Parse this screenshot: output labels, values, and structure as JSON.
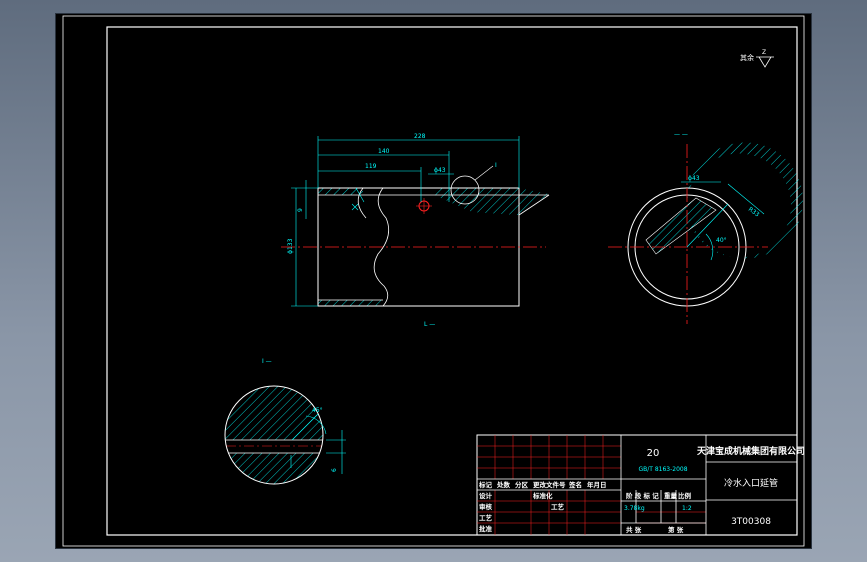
{
  "roughness": {
    "label": "其余",
    "symbol": "Z"
  },
  "view_labels": {
    "top_right": "— —",
    "bottom_left": "I —",
    "below_main": "L —"
  },
  "dimensions": {
    "overall_length": "228",
    "length_140": "140",
    "length_119": "119",
    "hole_dia": "ϕ43",
    "detail_ref": "I",
    "height_9": "9",
    "outer_dia": "ϕ133",
    "end_hole_dia": "ϕ43",
    "end_radius": "R33",
    "end_angle": "40°",
    "detail_angle": "45°",
    "detail_6": "6"
  },
  "title_block": {
    "material": "20",
    "standard": "GB/T 8163-2008",
    "company": "天津宝成机械集团有限公司",
    "part_name": "冷水入口延管",
    "drawing_number": "3T00308",
    "header_cells": [
      "标记",
      "处数",
      "分区",
      "更改文件号",
      "签名",
      "年月日"
    ],
    "row_labels": [
      "设计",
      "审核",
      "工艺",
      "批准"
    ],
    "standardize": "标准化",
    "process": "工艺",
    "stage_label": "阶 段 标 记",
    "weight_label": "重量",
    "scale_label": "比例",
    "weight_value": "3.78kg",
    "scale_value": "1:2",
    "sheets_total": "共 张",
    "sheet_no": "第 张"
  }
}
